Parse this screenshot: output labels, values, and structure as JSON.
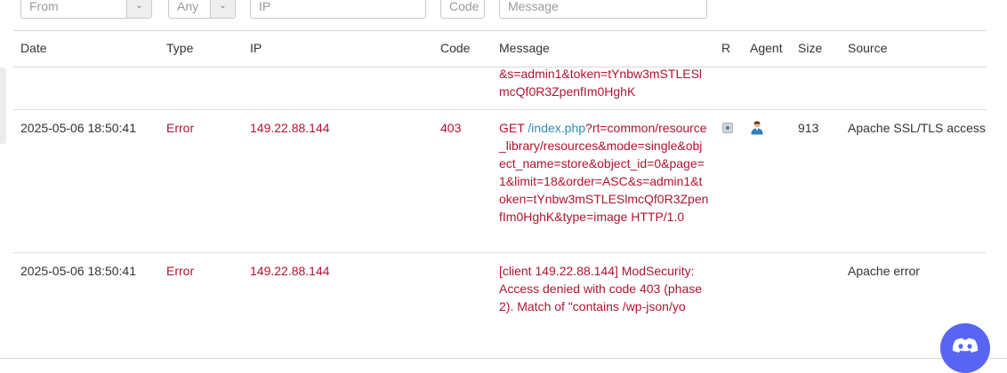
{
  "filters": {
    "from": "From",
    "type": "Any",
    "ip": "IP",
    "code": "Code",
    "message": "Message"
  },
  "columns": {
    "date": "Date",
    "type": "Type",
    "ip": "IP",
    "code": "Code",
    "message": "Message",
    "r": "R",
    "agent": "Agent",
    "size": "Size",
    "source": "Source"
  },
  "rows": [
    {
      "message_tail": "&s=admin1&token=tYnbw3mSTLESlmcQf0R3ZpenfIm0HghK"
    },
    {
      "date": "2025-05-06 18:50:41",
      "type": "Error",
      "ip": "149.22.88.144",
      "code": "403",
      "msg_prefix": "GET ",
      "msg_path": "/index.php",
      "msg_rest": "?rt=common/resource_library/resources&mode=single&object_name=store&object_id=0&page=1&limit=18&order=ASC&s=admin1&token=tYnbw3mSTLESlmcQf0R3ZpenfIm0HghK&type=image HTTP/1.0",
      "size": "913",
      "source": "Apache SSL/TLS access",
      "r_icon": "status-icon",
      "agent_icon": "user-agent-icon"
    },
    {
      "date": "2025-05-06 18:50:41",
      "type": "Error",
      "ip": "149.22.88.144",
      "code": "",
      "message": "[client 149.22.88.144] ModSecurity: Access denied with code 403 (phase 2). Match of \"contains /wp-json/yo",
      "source": "Apache error"
    }
  ],
  "widgets": {
    "chat": "discord-icon"
  }
}
